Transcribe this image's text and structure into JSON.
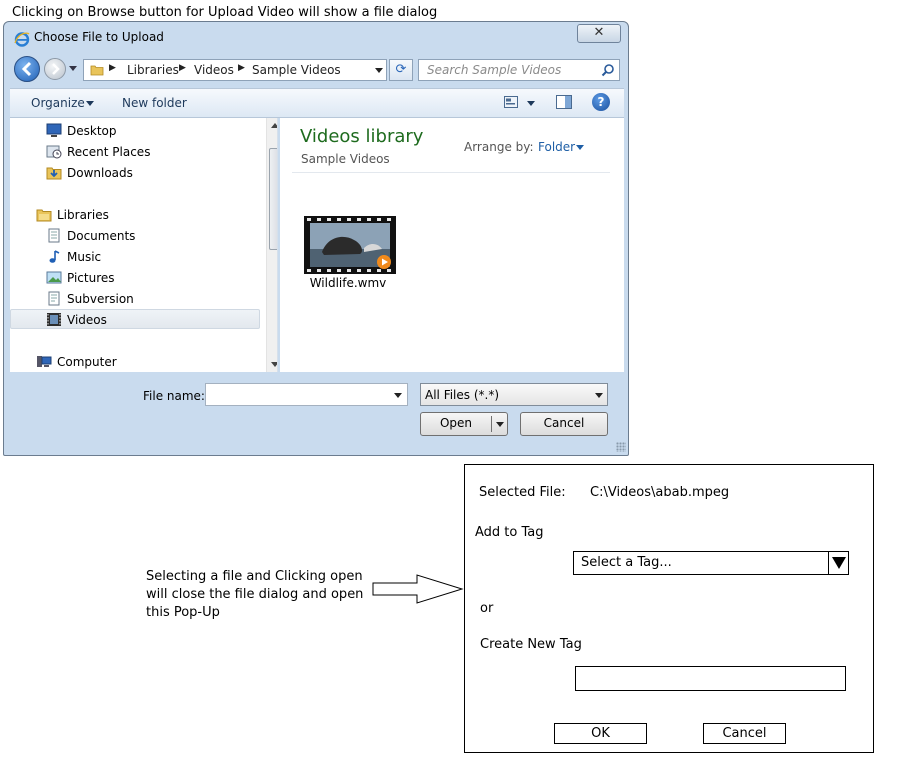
{
  "caption": "Clicking on Browse button for Upload Video will show a file dialog",
  "dialog": {
    "title": "Choose File to Upload",
    "close": "✕",
    "breadcrumb": [
      "Libraries",
      "Videos",
      "Sample Videos"
    ],
    "search_placeholder": "Search Sample Videos",
    "toolbar": {
      "organize": "Organize",
      "new_folder": "New folder",
      "help": "?"
    },
    "nav_items": [
      {
        "label": "Desktop",
        "icon": "desktop-icon"
      },
      {
        "label": "Recent Places",
        "icon": "recent-places-icon"
      },
      {
        "label": "Downloads",
        "icon": "downloads-icon"
      },
      {
        "label": "Libraries",
        "icon": "libraries-icon"
      },
      {
        "label": "Documents",
        "icon": "documents-icon"
      },
      {
        "label": "Music",
        "icon": "music-icon"
      },
      {
        "label": "Pictures",
        "icon": "pictures-icon"
      },
      {
        "label": "Subversion",
        "icon": "subversion-icon"
      },
      {
        "label": "Videos",
        "icon": "videos-icon",
        "selected": true
      },
      {
        "label": "Computer",
        "icon": "computer-icon"
      }
    ],
    "content": {
      "library_title": "Videos library",
      "library_subtitle": "Sample Videos",
      "arrange_label": "Arrange by:",
      "arrange_value": "Folder",
      "files": [
        {
          "name": "Wildlife.wmv"
        }
      ]
    },
    "footer": {
      "file_name_label": "File name:",
      "file_name_value": "",
      "filter": "All Files (*.*)",
      "open": "Open",
      "cancel": "Cancel"
    }
  },
  "annotation": "Selecting a file and Clicking open will close the file dialog and open this Pop-Up",
  "popup": {
    "selected_file_label": "Selected File:",
    "selected_file_value": "C:\\Videos\\abab.mpeg",
    "add_to_tag_label": "Add to Tag",
    "select_tag_value": "Select a Tag...",
    "or_label": "or",
    "create_new_tag_label": "Create New Tag",
    "new_tag_value": "",
    "ok": "OK",
    "cancel": "Cancel"
  },
  "colors": {
    "dialog_frame": "#c9dbee",
    "library_title": "#1e6b1e",
    "link_blue": "#1f5fa6"
  }
}
